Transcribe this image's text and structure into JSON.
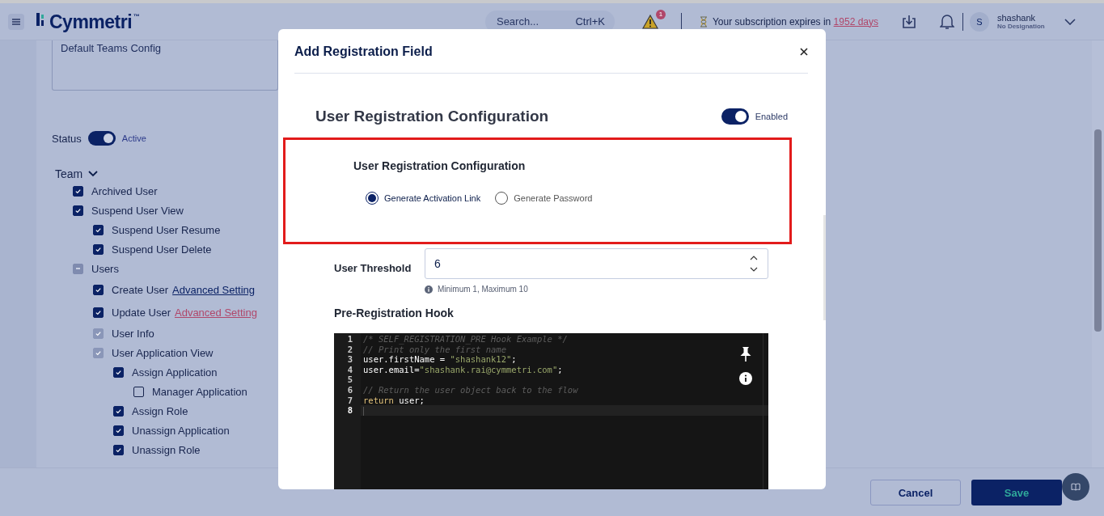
{
  "header": {
    "logo": "Cymmetri",
    "logo_mark": "™",
    "search": {
      "placeholder": "Search...",
      "shortcut": "Ctrl+K"
    },
    "alerts_badge": "1",
    "subscription": {
      "text": "Your subscription expires in ",
      "link": "1952 days"
    },
    "user": {
      "avatar": "S",
      "name": "shashank",
      "designation": "No Designation"
    }
  },
  "background_page": {
    "description": "Default Teams Config",
    "status": {
      "label": "Status",
      "on": true,
      "value": "Active"
    },
    "tree": {
      "label": "Team",
      "expanded": true,
      "children": [
        {
          "label": "Archived User",
          "checked": true,
          "partial": false,
          "disabled": false
        },
        {
          "label": "Suspend User View",
          "checked": true,
          "partial": false,
          "disabled": false,
          "children": [
            {
              "label": "Suspend User Resume",
              "checked": true,
              "partial": false,
              "disabled": false
            },
            {
              "label": "Suspend User Delete",
              "checked": true,
              "partial": false,
              "disabled": false
            }
          ]
        },
        {
          "label": "Users",
          "checked": false,
          "partial": true,
          "disabled": false,
          "children": [
            {
              "label": "Create User",
              "checked": true,
              "partial": false,
              "disabled": false,
              "link": {
                "text": "Advanced Setting",
                "color": "#0b2265"
              }
            },
            {
              "label": "Update User",
              "checked": true,
              "partial": false,
              "disabled": false,
              "link": {
                "text": "Advanced Setting",
                "color": "#b0476a"
              }
            },
            {
              "label": "User Info",
              "checked": true,
              "partial": false,
              "disabled": true
            },
            {
              "label": "User Application View",
              "checked": true,
              "partial": false,
              "disabled": true,
              "children": [
                {
                  "label": "Assign Application",
                  "checked": true,
                  "partial": false,
                  "disabled": false,
                  "children": [
                    {
                      "label": "Manager Application",
                      "checked": false,
                      "partial": false,
                      "disabled": false
                    }
                  ]
                },
                {
                  "label": "Assign Role",
                  "checked": true,
                  "partial": false,
                  "disabled": false
                },
                {
                  "label": "Unassign Application",
                  "checked": true,
                  "partial": false,
                  "disabled": false
                },
                {
                  "label": "Unassign Role",
                  "checked": true,
                  "partial": false,
                  "disabled": false
                }
              ]
            }
          ]
        }
      ]
    },
    "buttons": {
      "cancel": "Cancel",
      "save": "Save"
    }
  },
  "modal": {
    "title": "Add Registration Field",
    "heading": "User Registration Configuration",
    "enabled": {
      "on": true,
      "label": "Enabled"
    },
    "config": {
      "title": "User Registration Configuration",
      "options": [
        {
          "label": "Generate Activation Link",
          "selected": true
        },
        {
          "label": "Generate Password",
          "selected": false
        }
      ]
    },
    "threshold": {
      "label": "User Threshold",
      "value": "6",
      "hint": "Minimum 1, Maximum 10"
    },
    "hook": {
      "label": "Pre-Registration Hook",
      "lines": [
        {
          "number": "1",
          "active": false,
          "tokens": [
            {
              "kind": "comment",
              "text": "/* SELF_REGISTRATION_PRE Hook Example */"
            }
          ]
        },
        {
          "number": "2",
          "active": false,
          "tokens": [
            {
              "kind": "comment",
              "text": "// Print only the first name"
            }
          ]
        },
        {
          "number": "3",
          "active": false,
          "tokens": [
            {
              "kind": "plain",
              "text": "user.firstName = "
            },
            {
              "kind": "string",
              "text": "\"shashank12\""
            },
            {
              "kind": "plain",
              "text": ";"
            }
          ]
        },
        {
          "number": "4",
          "active": false,
          "tokens": [
            {
              "kind": "plain",
              "text": "user.email="
            },
            {
              "kind": "string",
              "text": "\"shashank.rai@cymmetri.com\""
            },
            {
              "kind": "plain",
              "text": ";"
            }
          ]
        },
        {
          "number": "5",
          "active": false
        },
        {
          "number": "6",
          "active": false,
          "tokens": [
            {
              "kind": "comment",
              "text": "// Return the user object back to the flow"
            }
          ]
        },
        {
          "number": "7",
          "active": false,
          "tokens": [
            {
              "kind": "keyword",
              "text": "return"
            },
            {
              "kind": "plain",
              "text": " user;"
            }
          ]
        },
        {
          "number": "8",
          "active": true
        }
      ]
    }
  }
}
